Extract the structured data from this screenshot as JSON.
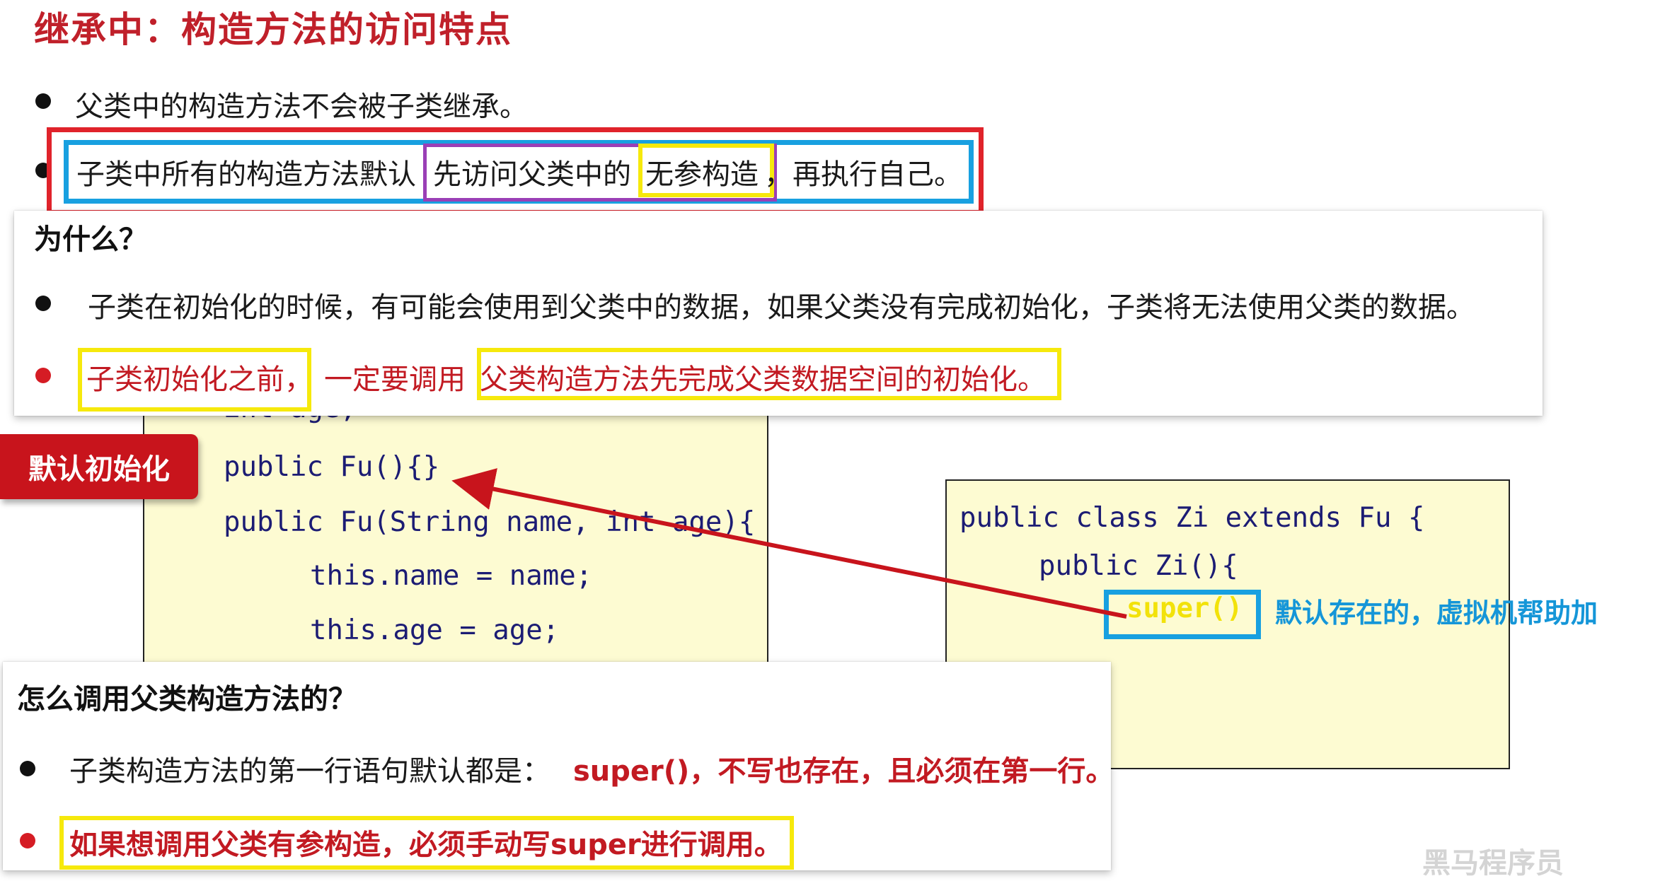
{
  "title": "继承中：构造方法的访问特点",
  "top_bullets": [
    "父类中的构造方法不会被子类继承。",
    {
      "part1": "子类中所有的构造方法默认",
      "part2": "先访问父类中的",
      "part3": "无参构造",
      "part4": "，再执行自己。"
    }
  ],
  "why_card": {
    "heading": "为什么？",
    "bullet1": "子类在初始化的时候，有可能会使用到父类中的数据，如果父类没有完成初始化，子类将无法使用父类的数据。",
    "bullet2_part1": "子类初始化之前，",
    "bullet2_part2": "一定要调用",
    "bullet2_part3": "父类构造方法先完成父类数据空间的初始化。"
  },
  "tag_label": "默认初始化",
  "fu_code": {
    "line0": "int age;",
    "line1": "public Fu(){}",
    "line2": "public Fu(String name, int age){",
    "line3_kw": "this",
    "line3_rest": ".name = name;",
    "line4_kw": "this",
    "line4_rest": ".age = age;"
  },
  "zi_code": {
    "line1": "public class Zi extends Fu {",
    "line2": "public Zi(){",
    "super_call": "super()",
    "note": "默认存在的，虚拟机帮助加"
  },
  "how_card": {
    "heading": "怎么调用父类构造方法的？",
    "bullet1_plain": "子类构造方法的第一行语句默认都是：",
    "bullet1_bold": "super()，不写也存在，且必须在第一行。",
    "bullet2": "如果想调用父类有参构造，必须手动写super进行调用。"
  },
  "watermark": "黑马程序员",
  "colors": {
    "title_red": "#c0202a",
    "highlight_red": "#e0232b",
    "highlight_blue": "#18a0e0",
    "highlight_purple": "#9a3fb6",
    "highlight_yellow": "#f6e90c",
    "code_bg": "#fdfbd2",
    "arrow": "#c8141c"
  }
}
